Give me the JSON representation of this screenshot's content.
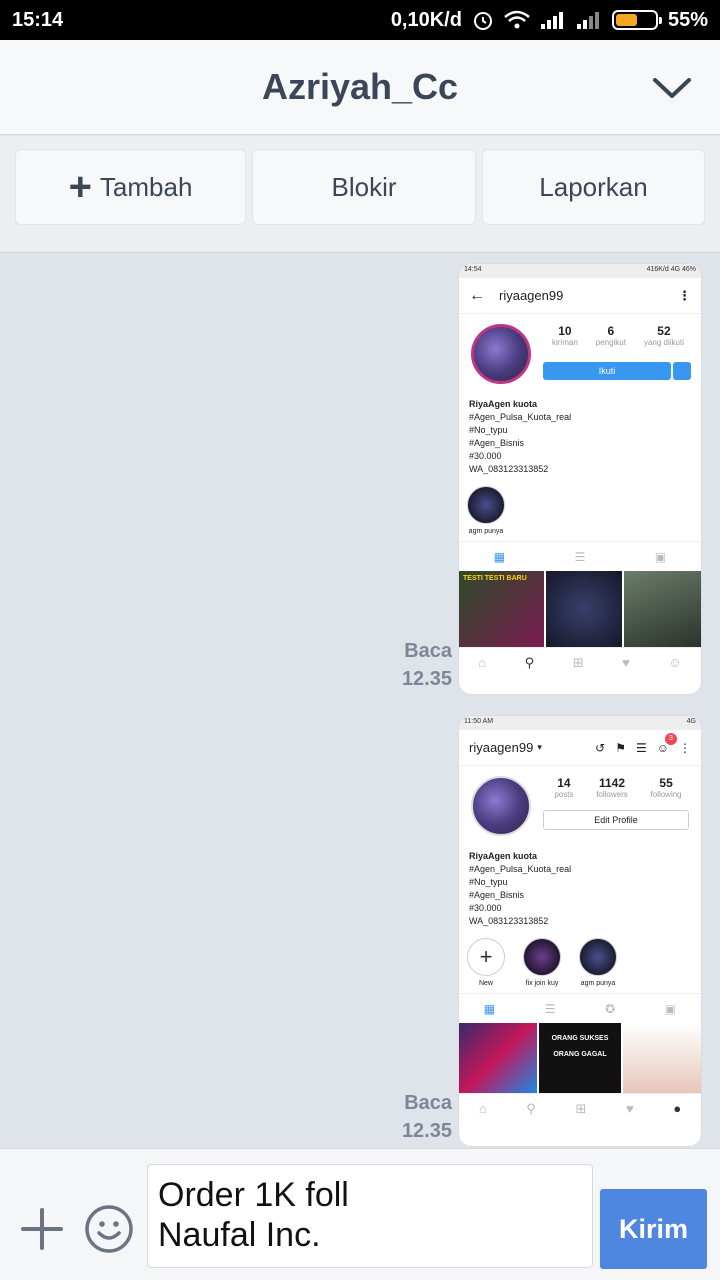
{
  "status_bar": {
    "time": "15:14",
    "speed": "0,10K/d",
    "battery": "55%",
    "battery_level": 0.55
  },
  "header": {
    "title": "Azriyah_Cc"
  },
  "actions": {
    "add_label": "Tambah",
    "block_label": "Blokir",
    "report_label": "Laporkan"
  },
  "messages": [
    {
      "read_status": "Baca",
      "time": "12.35",
      "screenshot": {
        "status_time": "14:54",
        "status_right": "416K/d 4G 46%",
        "username": "riyaagen99",
        "stats": [
          {
            "num": "10",
            "label": "kiriman"
          },
          {
            "num": "6",
            "label": "pengikut"
          },
          {
            "num": "52",
            "label": "yang diikuti"
          }
        ],
        "follow_label": "Ikuti",
        "bio_name": "RiyaAgen kuota",
        "bio_lines": [
          "#Agen_Pulsa_Kuota_real",
          "#No_typu",
          "#Agen_Bisnis",
          "#30.000",
          "WA_083123313852"
        ],
        "highlights": [
          "agm punya"
        ],
        "grid_text": "TESTI TESTI BARU"
      }
    },
    {
      "read_status": "Baca",
      "time": "12.35",
      "screenshot": {
        "status_time": "11:50 AM",
        "status_right": "4G",
        "username": "riyaagen99",
        "notification_count": "3",
        "stats": [
          {
            "num": "14",
            "label": "posts"
          },
          {
            "num": "1142",
            "label": "followers"
          },
          {
            "num": "55",
            "label": "following"
          }
        ],
        "edit_label": "Edit Profile",
        "bio_name": "RiyaAgen kuota",
        "bio_lines": [
          "#Agen_Pulsa_Kuota_real",
          "#No_typu",
          "#Agen_Bisnis",
          "#30.000",
          "WA_083123313852"
        ],
        "highlights": [
          "New",
          "fix join kuy",
          "agm punya"
        ],
        "grid_text_1": "ORANG SUKSES",
        "grid_text_2": "ORANG GAGAL"
      }
    }
  ],
  "composer": {
    "text": "Order 1K foll\nNaufal Inc.",
    "send_label": "Kirim"
  },
  "colors": {
    "accent": "#4f86e0",
    "title": "#3c4657",
    "background": "#dfe4eb"
  }
}
